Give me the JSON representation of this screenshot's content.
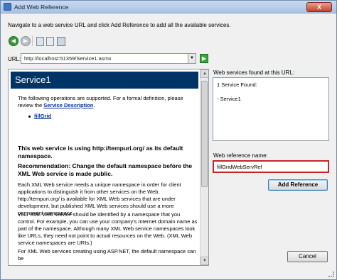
{
  "window": {
    "title": "Add Web Reference",
    "close_label": "X"
  },
  "instructions": "Navigate to a web service URL and click Add Reference to add all the available services.",
  "toolbar": {
    "back_icon": "back-arrow-icon",
    "forward_icon": "forward-arrow-icon",
    "stop_icon": "stop-icon",
    "refresh_icon": "refresh-icon",
    "home_icon": "home-icon"
  },
  "url": {
    "label": "URL:",
    "value": "http://localhost:51359/Service1.asmx",
    "go_icon": "go-arrow-icon"
  },
  "browser": {
    "service_title": "Service1",
    "intro": "The following operations are supported. For a formal definition, please review the",
    "service_description_link": "Service Description",
    "intro_end": ".",
    "operation": "fillGrid",
    "ns_heading": "This web service is using http://tempuri.org/ as its default namespace.",
    "recommendation": "Recommendation: Change the default namespace before the XML Web service is made public.",
    "para1": "Each XML Web service needs a unique namespace in order for client applications to distinguish it from other services on the Web. http://tempuri.org/ is available for XML Web services that are under development, but published XML Web services should use a more permanent namespace.",
    "para2": "Your XML Web service should be identified by a namespace that you control. For example, you can use your company's Internet domain name as part of the namespace. Although many XML Web service namespaces look like URLs, they need not point to actual resources on the Web. (XML Web service namespaces are URIs.)",
    "para3": "For XML Web services creating using ASP.NET, the default namespace can be"
  },
  "services_found": {
    "label": "Web services found at this URL:",
    "count_text": "1 Service Found:",
    "item": "- Service1"
  },
  "reference_name": {
    "label": "Web reference name:",
    "value": "fillGridWebServRef"
  },
  "buttons": {
    "add_reference": "Add Reference",
    "cancel": "Cancel"
  },
  "colors": {
    "header_bg": "#003366",
    "highlight_border": "#c8232a",
    "link": "#003399"
  }
}
